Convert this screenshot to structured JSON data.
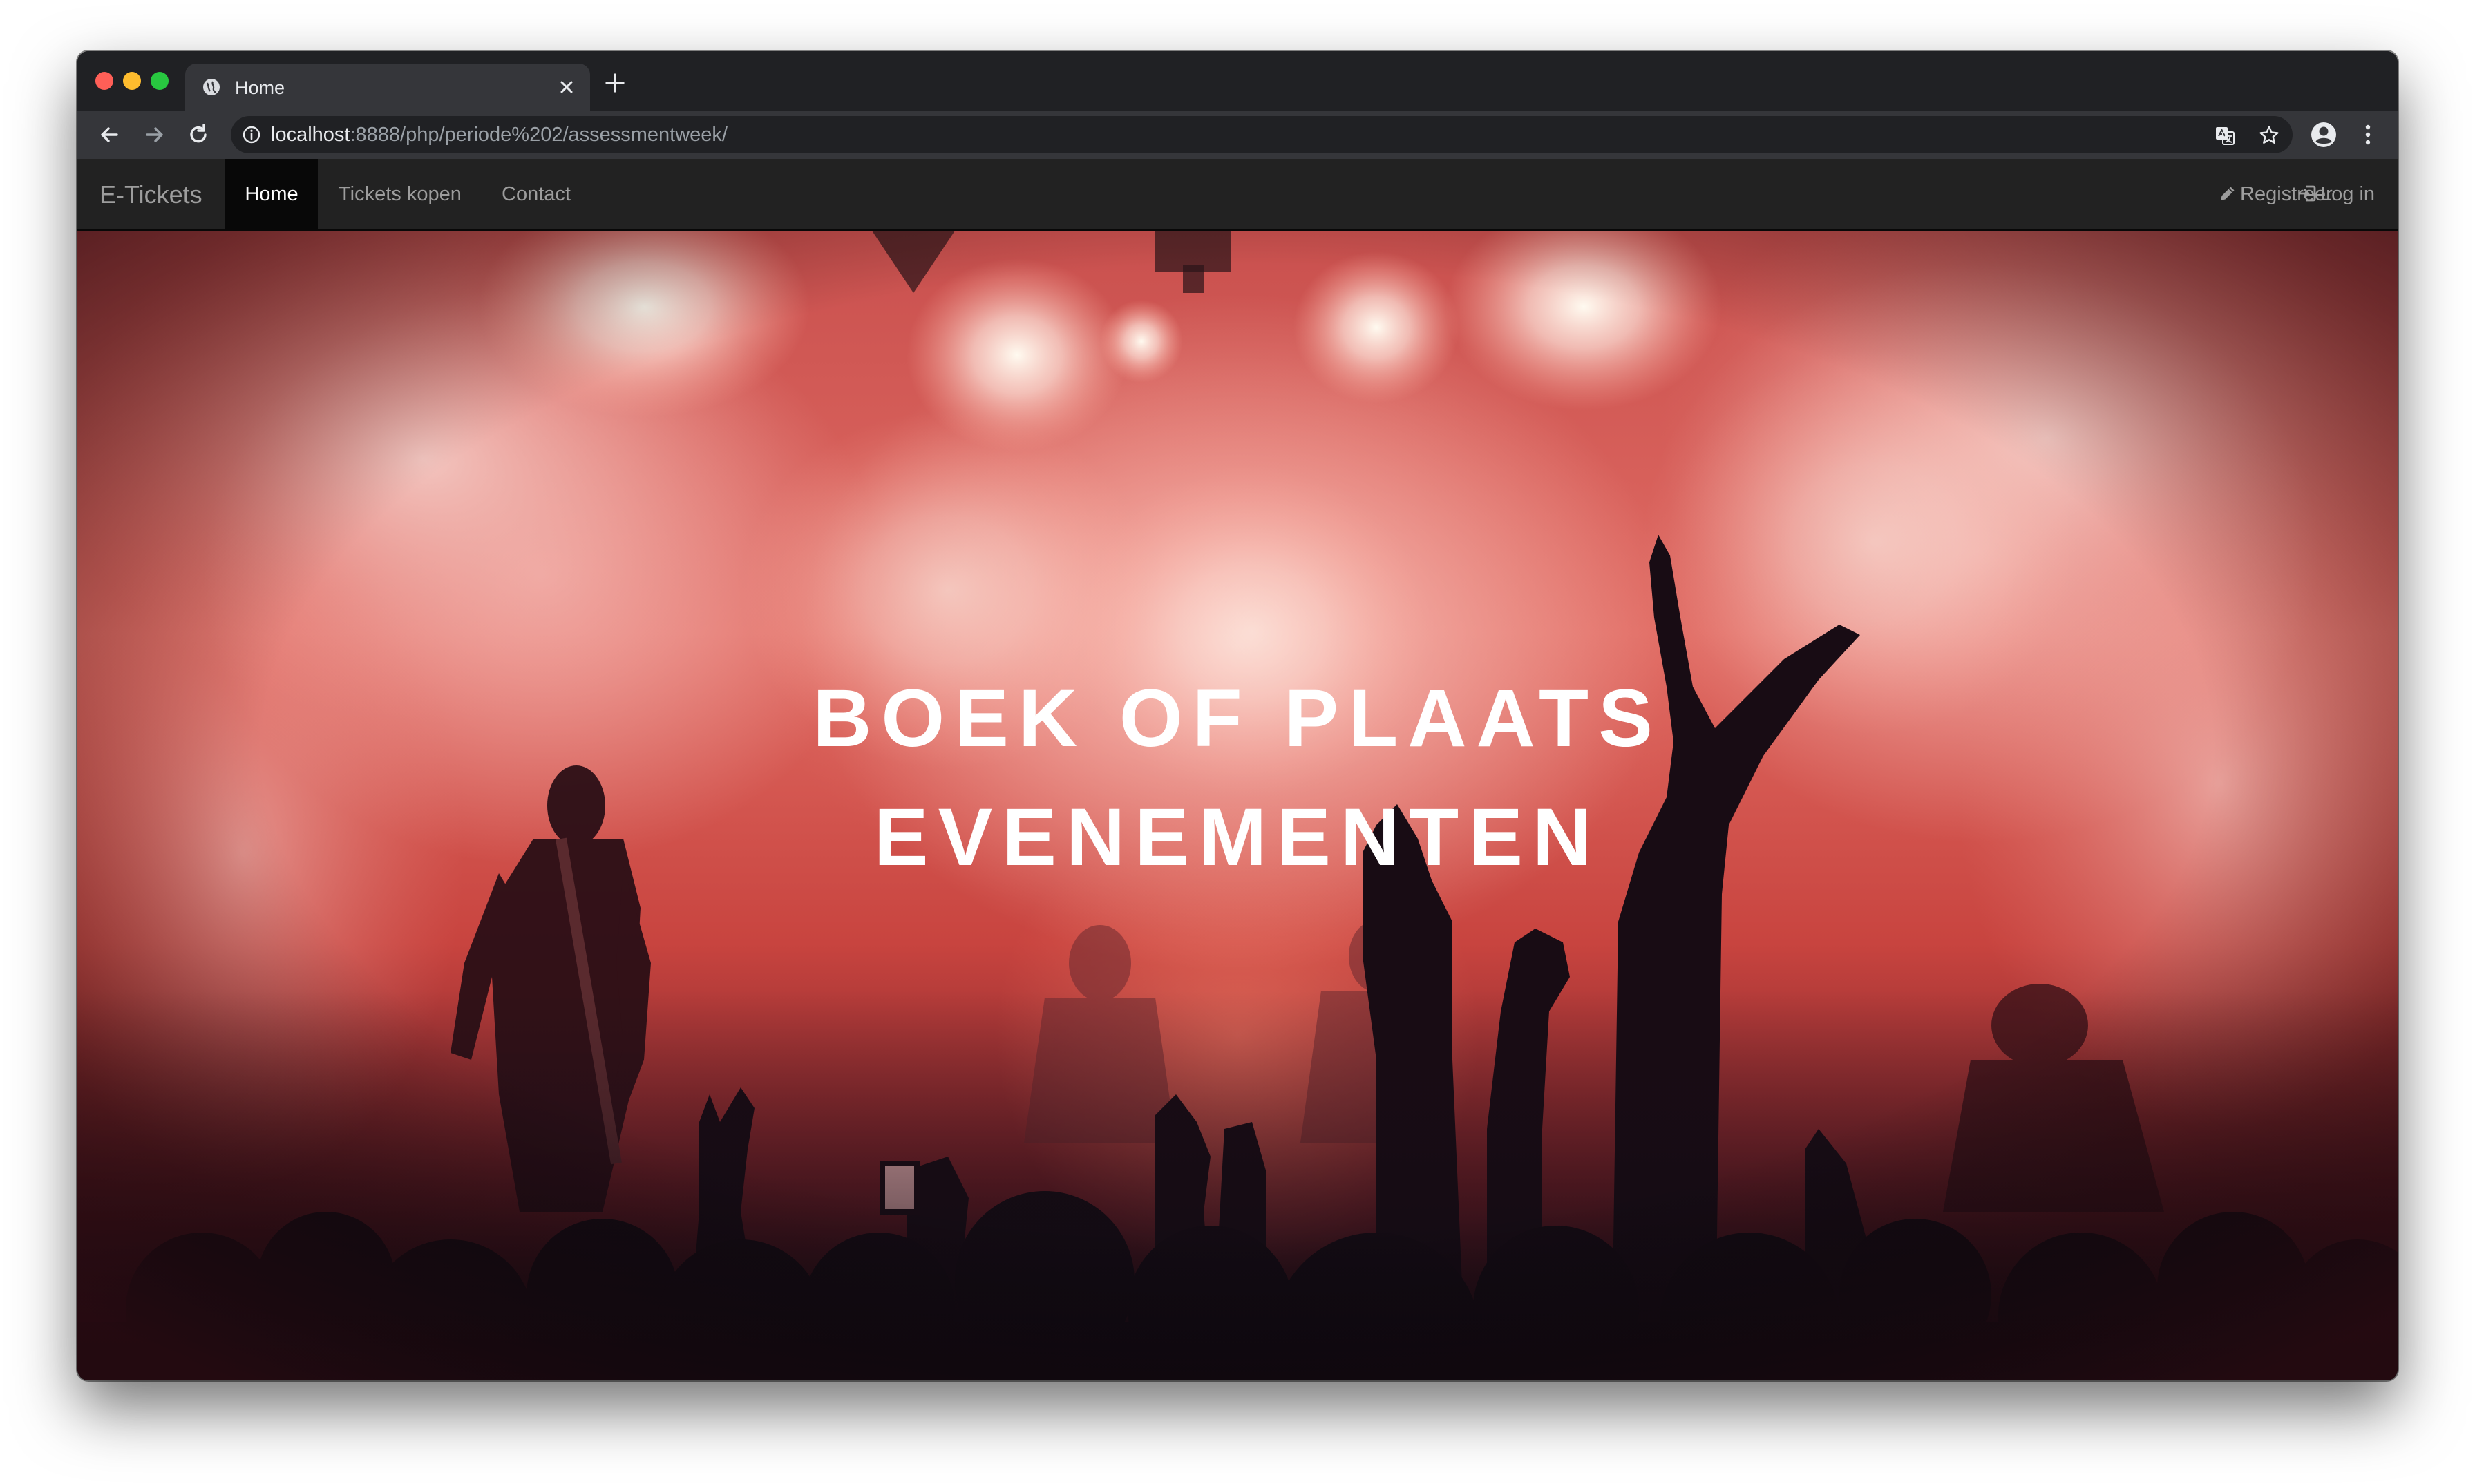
{
  "browser": {
    "tab": {
      "title": "Home",
      "favicon": "globe-icon"
    },
    "new_tab_icon": "plus-icon",
    "url_host": "localhost",
    "url_path": ":8888/php/periode%202/assessmentweek/",
    "icons": {
      "back": "arrow-left-icon",
      "forward": "arrow-right-icon",
      "reload": "reload-icon",
      "info": "info-icon",
      "translate": "translate-icon",
      "bookmark": "star-icon",
      "profile": "account-icon",
      "menu": "kebab-menu-icon"
    }
  },
  "navbar": {
    "brand": "E-Tickets",
    "items": [
      {
        "label": "Home",
        "active": true
      },
      {
        "label": "Tickets kopen",
        "active": false
      },
      {
        "label": "Contact",
        "active": false
      }
    ],
    "right": [
      {
        "label": "Registreer",
        "icon": "pencil-icon"
      },
      {
        "label": "Log in",
        "icon": "log-in-icon"
      }
    ],
    "colors": {
      "bar": "#222222",
      "active": "#080808",
      "text": "#9d9d9d"
    }
  },
  "hero": {
    "title_line1": "BOEK OF PLAATS",
    "title_line2": "EVENEMENTEN",
    "image": "concert-crowd-red-stage-lights-photo"
  }
}
